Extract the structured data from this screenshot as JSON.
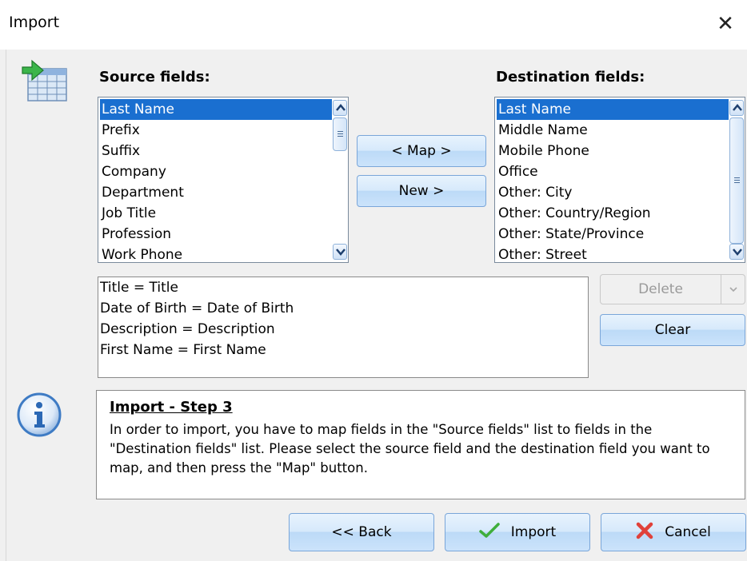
{
  "window": {
    "title": "Import",
    "close_glyph": "✕"
  },
  "source": {
    "label": "Source fields:",
    "items": [
      "Last Name",
      "Prefix",
      "Suffix",
      "Company",
      "Department",
      "Job Title",
      "Profession",
      "Work Phone"
    ],
    "selected_index": 0
  },
  "destination": {
    "label": "Destination fields:",
    "items": [
      "Last Name",
      "Middle Name",
      "Mobile Phone",
      "Office",
      "Other: City",
      "Other: Country/Region",
      "Other: State/Province",
      "Other: Street"
    ],
    "selected_index": 0
  },
  "buttons": {
    "map": "< Map >",
    "new": "New >",
    "delete": "Delete",
    "clear": "Clear",
    "back": "<< Back",
    "import": "Import",
    "cancel": "Cancel"
  },
  "mappings": [
    "Title = Title",
    "Date of Birth = Date of Birth",
    "Description = Description",
    "First Name = First Name"
  ],
  "info": {
    "heading": "Import - Step 3",
    "text": "In order to import, you have to map fields in the \"Source fields\" list to fields in the \"Destination fields\" list. Please select the source field and the destination field you want to map, and then press the \"Map\" button."
  },
  "icons": {
    "wizard": "import-table-icon",
    "info": "info-icon",
    "import": "checkmark-icon",
    "cancel": "cross-icon"
  },
  "colors": {
    "selection": "#1a6fd0",
    "button_border": "#7aa6d9"
  }
}
